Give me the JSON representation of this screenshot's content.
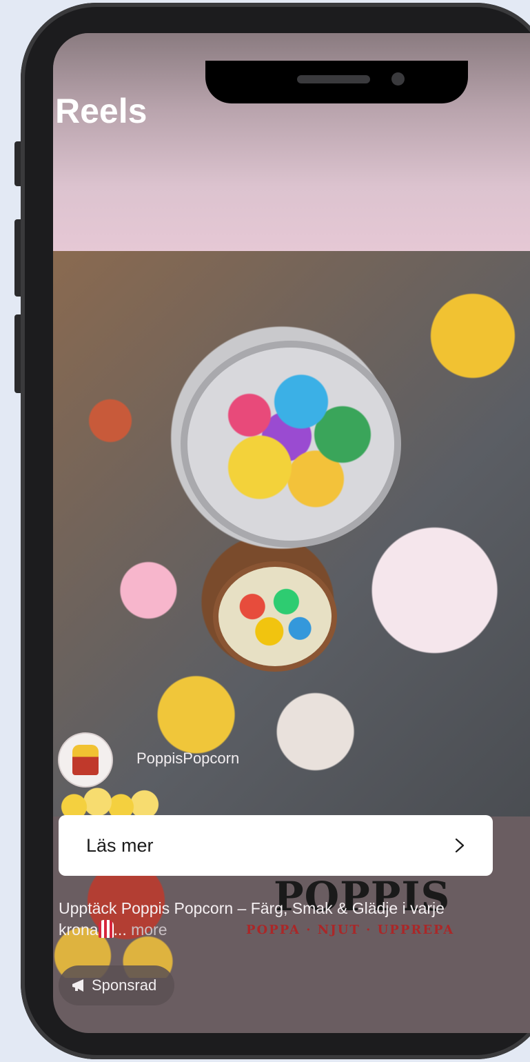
{
  "header": {
    "title": "Reels"
  },
  "post": {
    "username": "PoppisPopcorn",
    "cta_label": "Läs mer",
    "caption": "Upptäck Poppis Popcorn – Färg, Smak & Glädje i varje krona",
    "caption_suffix": "...",
    "more_label": "more",
    "sponsored_label": "Sponsrad"
  },
  "ad_art": {
    "brand": "POPPIS",
    "tagline": "POPPA · NJUT · UPPREPA"
  },
  "icons": [
    "chevron-right-icon",
    "megaphone-icon",
    "popcorn-emoji"
  ],
  "colors": {
    "cta_background": "#ffffff",
    "header_gradient_end": "#e6c8d5"
  }
}
